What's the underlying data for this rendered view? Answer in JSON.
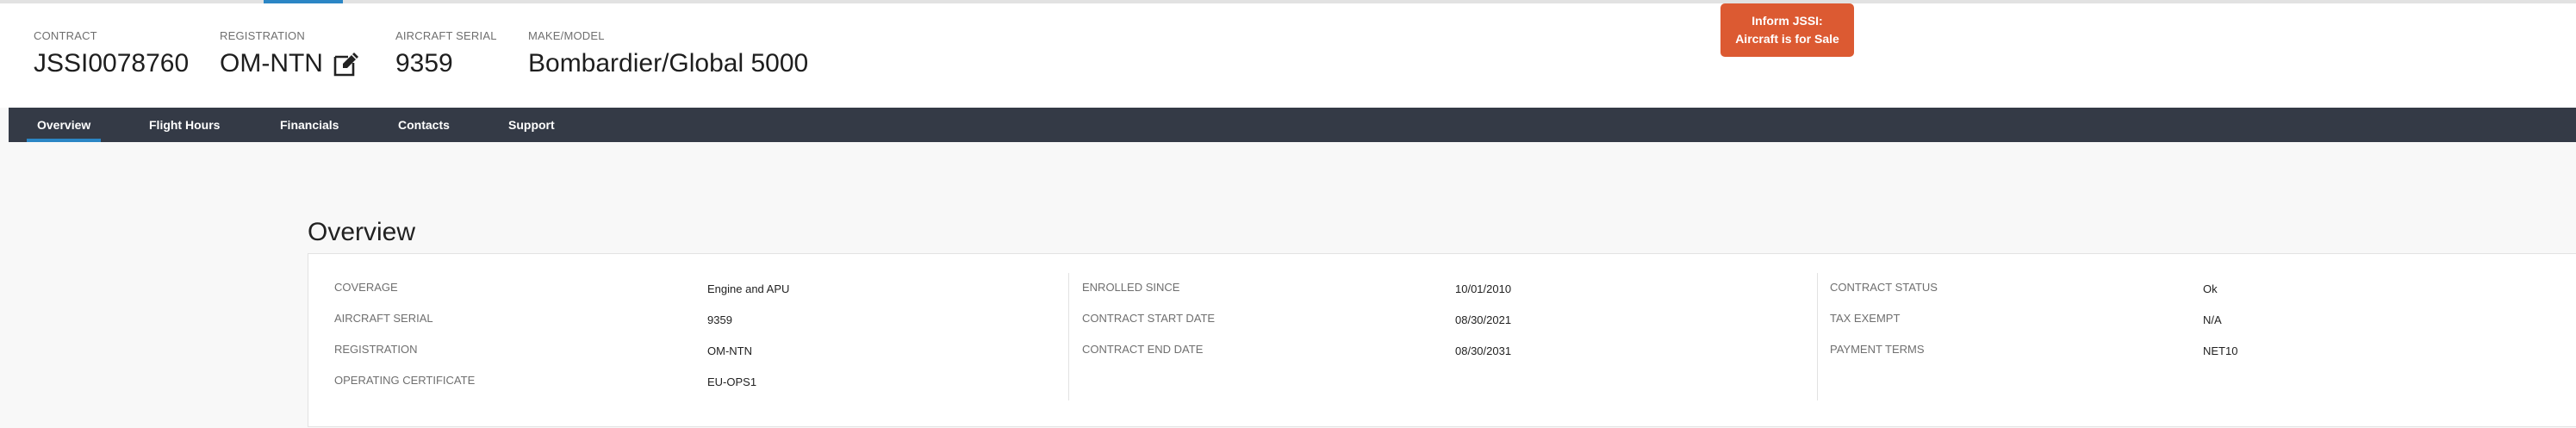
{
  "header": {
    "contract": {
      "label": "CONTRACT",
      "value": "JSSI0078760"
    },
    "registration": {
      "label": "REGISTRATION",
      "value": "OM-NTN"
    },
    "aircraft_serial": {
      "label": "AIRCRAFT SERIAL",
      "value": "9359"
    },
    "make_model": {
      "label": "MAKE/MODEL",
      "value": "Bombardier/Global 5000"
    },
    "inform_button": {
      "line1": "Inform JSSI:",
      "line2": "Aircraft is for Sale"
    }
  },
  "nav": {
    "active": "Overview",
    "tabs": [
      {
        "label": "Overview"
      },
      {
        "label": "Flight Hours"
      },
      {
        "label": "Financials"
      },
      {
        "label": "Contacts"
      },
      {
        "label": "Support"
      }
    ]
  },
  "overview": {
    "title": "Overview",
    "columns": [
      {
        "rows": [
          {
            "label": "COVERAGE",
            "value": "Engine and APU"
          },
          {
            "label": "AIRCRAFT SERIAL",
            "value": "9359"
          },
          {
            "label": "REGISTRATION",
            "value": "OM-NTN"
          },
          {
            "label": "OPERATING CERTIFICATE",
            "value": "EU-OPS1"
          }
        ]
      },
      {
        "rows": [
          {
            "label": "ENROLLED SINCE",
            "value": "10/01/2010"
          },
          {
            "label": "CONTRACT START DATE",
            "value": "08/30/2021"
          },
          {
            "label": "CONTRACT END DATE",
            "value": "08/30/2031"
          }
        ]
      },
      {
        "rows": [
          {
            "label": "CONTRACT STATUS",
            "value": "Ok"
          },
          {
            "label": "TAX EXEMPT",
            "value": "N/A"
          },
          {
            "label": "PAYMENT TERMS",
            "value": "NET10"
          }
        ]
      }
    ]
  },
  "colors": {
    "accent": "#2b86c5",
    "nav_bg": "#343a46",
    "alert_button": "#dc5a32"
  },
  "icons": {
    "registration_edit": "edit-icon"
  }
}
